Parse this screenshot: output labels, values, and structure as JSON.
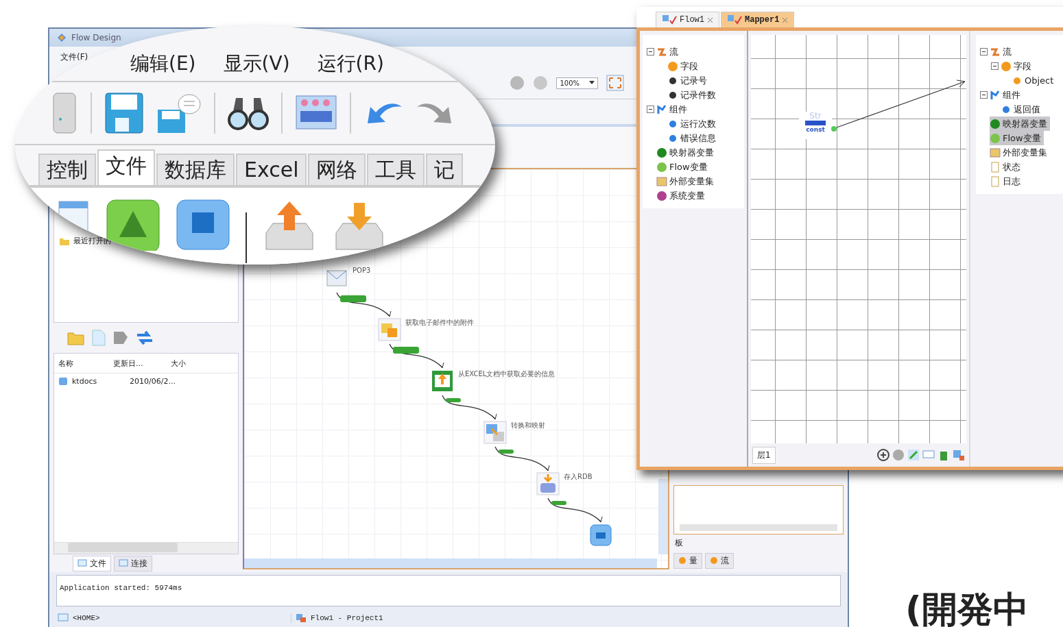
{
  "main_window": {
    "title": "Flow Design",
    "menu": [
      "文件(F)"
    ],
    "zoom": "100%",
    "recent_label": "最近打开的",
    "file_list": {
      "columns": [
        "名称",
        "更新日...",
        "大小"
      ],
      "rows": [
        [
          "ktdocs",
          "2010/06/2..."
        ]
      ]
    },
    "left_tabs": [
      {
        "label": "文件",
        "selected": true
      },
      {
        "label": "连接",
        "selected": false
      }
    ],
    "flow_nodes": [
      {
        "kind": "pop3",
        "label": "POP3"
      },
      {
        "kind": "mail",
        "label": "获取电子邮件中的附件"
      },
      {
        "kind": "excel",
        "label": "从EXCEL文档中获取必要的信息"
      },
      {
        "kind": "map",
        "label": "转换和映射"
      },
      {
        "kind": "db",
        "label": "存入RDB"
      },
      {
        "kind": "end"
      }
    ],
    "right_panel": {
      "label": "板",
      "tabs": [
        "量",
        "流"
      ]
    },
    "log": "Application started: 5974ms",
    "status": [
      "<HOME>",
      "Flow1 - Project1"
    ]
  },
  "magnifier": {
    "menu": [
      "编辑(E)",
      "显示(V)",
      "运行(R)"
    ],
    "tabs": [
      {
        "label": "控制",
        "selected": false
      },
      {
        "label": "文件",
        "selected": true
      },
      {
        "label": "数据库",
        "selected": false
      },
      {
        "label": "Excel",
        "selected": false
      },
      {
        "label": "网络",
        "selected": false
      },
      {
        "label": "工具",
        "selected": false
      },
      {
        "label": "记",
        "selected": false
      }
    ]
  },
  "mapper_window": {
    "tabs": [
      {
        "label": "Flow1",
        "selected": false
      },
      {
        "label": "Mapper1",
        "selected": true
      }
    ],
    "left_tree": [
      {
        "kind": "flow",
        "label": "流",
        "expanded": true,
        "selected": false,
        "children": [
          {
            "kind": "field",
            "label": "字段",
            "selected": false
          },
          {
            "kind": "record",
            "label": "记录号",
            "selected": false
          },
          {
            "kind": "record",
            "label": "记录件数",
            "selected": false
          }
        ]
      },
      {
        "kind": "component",
        "label": "组件",
        "expanded": true,
        "selected": false,
        "children": [
          {
            "kind": "param",
            "label": "运行次数",
            "selected": false
          },
          {
            "kind": "param",
            "label": "错误信息",
            "selected": false
          }
        ]
      },
      {
        "kind": "mappervar",
        "label": "映射器变量",
        "selected": false
      },
      {
        "kind": "flowvar",
        "label": "Flow变量",
        "selected": false
      },
      {
        "kind": "extvars",
        "label": "外部变量集",
        "selected": false
      },
      {
        "kind": "sysvar",
        "label": "系统变量",
        "selected": false
      }
    ],
    "node": {
      "type": "Str",
      "label": "const"
    },
    "layer_tab": "层1",
    "right_tree": [
      {
        "kind": "flow",
        "label": "流",
        "expanded": true,
        "selected": false,
        "children": [
          {
            "kind": "field",
            "label": "字段",
            "expanded": true,
            "selected": false,
            "children": [
              {
                "kind": "object",
                "label": "Object",
                "selected": false
              }
            ]
          }
        ]
      },
      {
        "kind": "component",
        "label": "组件",
        "expanded": true,
        "selected": false,
        "children": [
          {
            "kind": "param",
            "label": "返回值",
            "selected": false
          }
        ]
      },
      {
        "kind": "mappervar",
        "label": "映射器变量",
        "selected": true
      },
      {
        "kind": "flowvar",
        "label": "Flow变量",
        "selected": true
      },
      {
        "kind": "extvars",
        "label": "外部变量集",
        "selected": false
      },
      {
        "kind": "doc",
        "label": "状态",
        "selected": false
      },
      {
        "kind": "doc",
        "label": "日志",
        "selected": false
      }
    ]
  },
  "caption": "(開発中"
}
